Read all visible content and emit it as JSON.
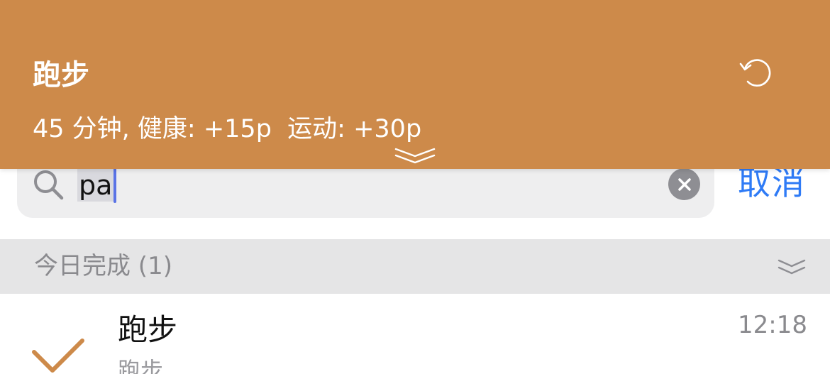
{
  "toast": {
    "title": "跑步",
    "detail": "45 分钟, 健康: +15p  运动: +30p",
    "undo_icon": "undo-icon",
    "handle_icon": "double-chevron-down-icon",
    "background": "#cd8a4a"
  },
  "search": {
    "value": "pa",
    "search_icon": "search-icon",
    "clear_icon": "clear-icon",
    "cancel_label": "取消",
    "cancel_color": "#2f7bf6"
  },
  "section": {
    "title": "今日完成 (1)",
    "chevron_icon": "double-chevron-down-icon"
  },
  "items": [
    {
      "title": "跑步",
      "subtitle": "跑步",
      "time": "12:18",
      "status_icon": "checkmark-icon",
      "accent": "#cd8a4a"
    }
  ]
}
